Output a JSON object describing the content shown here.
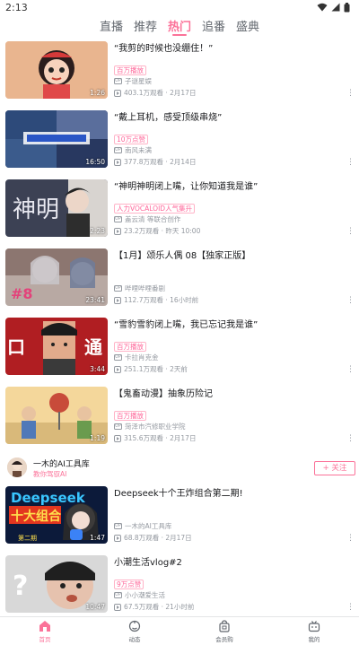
{
  "status_bar": {
    "time": "2:13"
  },
  "top_tabs": [
    {
      "label": "直播",
      "active": false
    },
    {
      "label": "推荐",
      "active": false
    },
    {
      "label": "热门",
      "active": true
    },
    {
      "label": "追番",
      "active": false
    },
    {
      "label": "盛典",
      "active": false
    }
  ],
  "videos": [
    {
      "title": "“我剪的时候也没绷住！”",
      "tag": "百万播放",
      "up": "子谜星娱",
      "stats": "403.1万观看 · 2月17日",
      "duration": "1:26"
    },
    {
      "title": "“戴上耳机，感受顶级串烧”",
      "tag": "10万点赞",
      "up": "南风未满",
      "stats": "377.8万观看 · 2月14日",
      "duration": "16:50"
    },
    {
      "title": "“神明神明闭上嘴，让你知道我是谁”",
      "tag": "人力VOCALOID人气集升",
      "up": "盖云清 等联合创作",
      "stats": "23.2万观看 · 昨天 10:00",
      "duration": "2:23"
    },
    {
      "title": "【1月】颂乐人偶 08【独家正版】",
      "tag": "",
      "up": "哔哩哔哩番剧",
      "stats": "112.7万观看 · 16小时前",
      "duration": "23:41"
    },
    {
      "title": "“雪豹雪豹闭上嘴，我已忘记我是谁”",
      "tag": "百万播放",
      "up": "卡拉肖克金",
      "stats": "251.1万观看 · 2天前",
      "duration": "3:44"
    },
    {
      "title": "【鬼畜动漫】抽象历险记",
      "tag": "百万播放",
      "up": "菏泽市汽修职业学院",
      "stats": "315.6万观看 · 2月17日",
      "duration": "1:19"
    },
    {
      "title": "Deepseek十个王炸组合第二期!",
      "tag": "",
      "up": "一木的AI工具库",
      "stats": "68.8万观看 · 2月17日",
      "duration": "1:47"
    },
    {
      "title": "小潮生活vlog#2",
      "tag": "9万点赞",
      "up": "小小潮爱生活",
      "stats": "67.5万观看 · 21小时前",
      "duration": "10:47"
    }
  ],
  "up_card": {
    "name": "一木的AI工具库",
    "subtitle": "教你驾驭AI",
    "follow_label": "+ 关注"
  },
  "bottom_nav": [
    {
      "label": "首页",
      "icon": "home-icon",
      "active": true
    },
    {
      "label": "动态",
      "icon": "dynamic-icon",
      "active": false
    },
    {
      "label": "会员购",
      "icon": "shop-bag-icon",
      "active": false
    },
    {
      "label": "我的",
      "icon": "tv-icon",
      "active": false
    }
  ],
  "colors": {
    "accent": "#fb7299",
    "text": "#18191c",
    "muted": "#9499a0"
  }
}
